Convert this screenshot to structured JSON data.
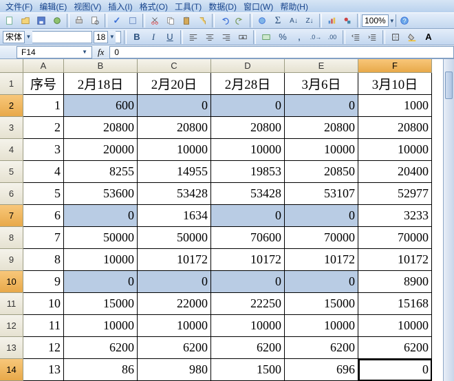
{
  "menu": {
    "file": "文件(F)",
    "edit": "编辑(E)",
    "view": "视图(V)",
    "insert": "插入(I)",
    "format": "格式(O)",
    "tools": "工具(T)",
    "data": "数据(D)",
    "window": "窗口(W)",
    "help": "帮助(H)"
  },
  "zoom": "100%",
  "font": {
    "name": "宋体",
    "size": "18"
  },
  "namebox": "F14",
  "formula": "0",
  "colLabels": [
    "A",
    "B",
    "C",
    "D",
    "E",
    "F"
  ],
  "rowLabels": [
    "1",
    "2",
    "3",
    "4",
    "5",
    "6",
    "7",
    "8",
    "9",
    "10",
    "11",
    "12",
    "13",
    "14"
  ],
  "selectedRows": [
    2,
    7,
    10,
    14
  ],
  "selectedCol": "F",
  "activeCell": {
    "row": 14,
    "col": "F"
  },
  "headers": {
    "a": "序号",
    "b": "2月18日",
    "c": "2月20日",
    "d": "2月28日",
    "e": "3月6日",
    "f": "3月10日"
  },
  "rows": [
    {
      "a": "1",
      "b": "600",
      "c": "0",
      "d": "0",
      "e": "0",
      "f": "1000",
      "hl": [
        "b",
        "c",
        "d",
        "e"
      ]
    },
    {
      "a": "2",
      "b": "20800",
      "c": "20800",
      "d": "20800",
      "e": "20800",
      "f": "20800",
      "hl": []
    },
    {
      "a": "3",
      "b": "20000",
      "c": "10000",
      "d": "10000",
      "e": "10000",
      "f": "10000",
      "hl": []
    },
    {
      "a": "4",
      "b": "8255",
      "c": "14955",
      "d": "19853",
      "e": "20850",
      "f": "20400",
      "hl": []
    },
    {
      "a": "5",
      "b": "53600",
      "c": "53428",
      "d": "53428",
      "e": "53107",
      "f": "52977",
      "hl": []
    },
    {
      "a": "6",
      "b": "0",
      "c": "1634",
      "d": "0",
      "e": "0",
      "f": "3233",
      "hl": [
        "b",
        "d",
        "e"
      ]
    },
    {
      "a": "7",
      "b": "50000",
      "c": "50000",
      "d": "70600",
      "e": "70000",
      "f": "70000",
      "hl": []
    },
    {
      "a": "8",
      "b": "10000",
      "c": "10172",
      "d": "10172",
      "e": "10172",
      "f": "10172",
      "hl": []
    },
    {
      "a": "9",
      "b": "0",
      "c": "0",
      "d": "0",
      "e": "0",
      "f": "8900",
      "hl": [
        "b",
        "c",
        "d",
        "e"
      ]
    },
    {
      "a": "10",
      "b": "15000",
      "c": "22000",
      "d": "22250",
      "e": "15000",
      "f": "15168",
      "hl": []
    },
    {
      "a": "11",
      "b": "10000",
      "c": "10000",
      "d": "10000",
      "e": "10000",
      "f": "10000",
      "hl": []
    },
    {
      "a": "12",
      "b": "6200",
      "c": "6200",
      "d": "6200",
      "e": "6200",
      "f": "6200",
      "hl": []
    },
    {
      "a": "13",
      "b": "86",
      "c": "980",
      "d": "1500",
      "e": "696",
      "f": "0",
      "hl": []
    }
  ]
}
